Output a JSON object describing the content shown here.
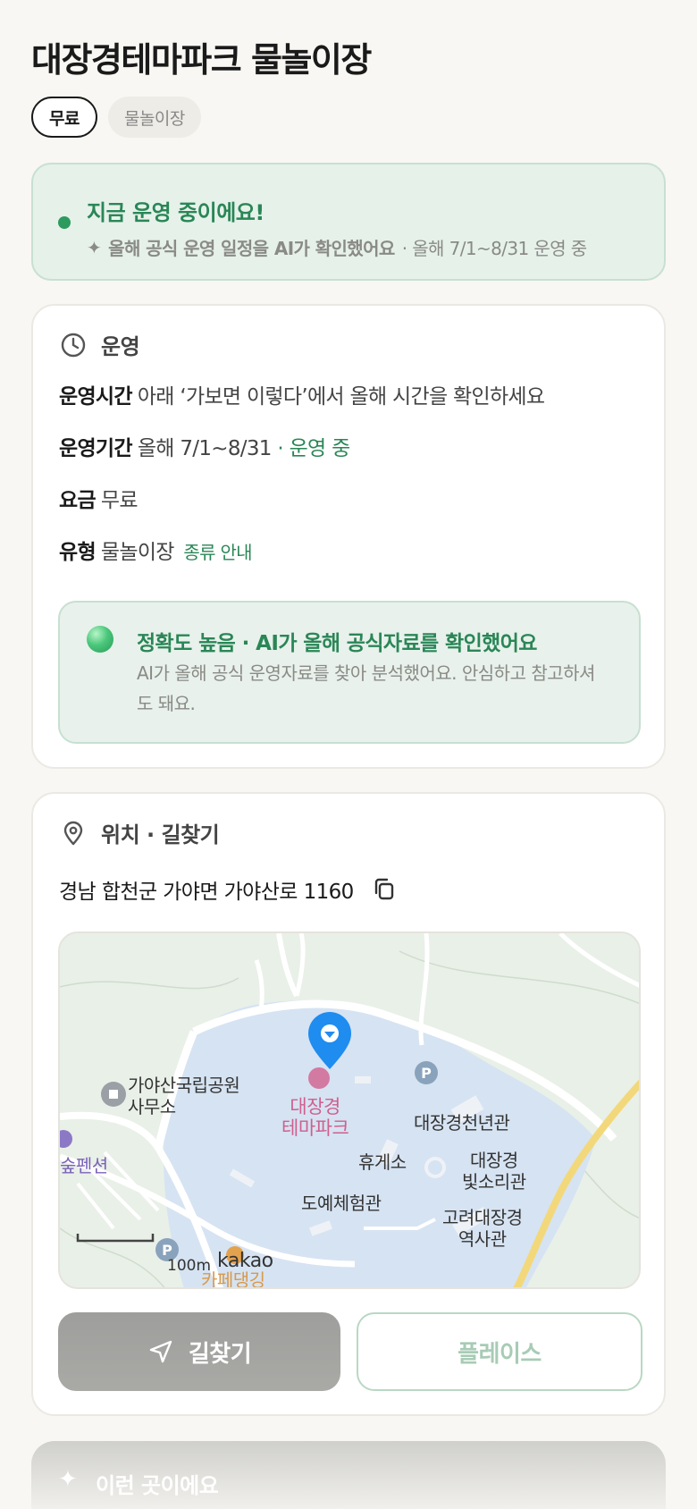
{
  "header": {
    "title": "대장경테마파크 물놀이장",
    "chips": [
      "무료",
      "물놀이장"
    ]
  },
  "status": {
    "title": "지금 운영 중이에요!",
    "sub_em": "올해 공식 운영 일정을 AI가 확인했어요",
    "sub_rest": "· 올해 7/1~8/31 운영 중"
  },
  "operation": {
    "section_label": "운영",
    "hours_key": "운영시간",
    "hours_value": "아래 ‘가보면 이렇다’에서 올해 시간을 확인하세요",
    "period_key": "운영기간",
    "period_value": "올해 7/1~8/31",
    "period_status": "· 운영 중",
    "fee_key": "요금",
    "fee_value": "무료",
    "type_key": "유형",
    "type_value": "물놀이장",
    "type_link": "종류 안내",
    "accuracy_title": "정확도 높음 · AI가 올해 공식자료를 확인했어요",
    "accuracy_body": "AI가 올해 공식 운영자료를 찾아 분석했어요. 안심하고 참고하셔도 돼요."
  },
  "location": {
    "section_label": "위치 · 길찾기",
    "address": "경남 합천군 가야면 가야산로 1160",
    "map_labels": {
      "park_office_1": "가야산국립공원",
      "park_office_2": "사무소",
      "theme_park_1": "대장경",
      "theme_park_2": "테마파크",
      "hall_1000": "대장경천년관",
      "rest_area": "휴게소",
      "sound_hall_1": "대장경",
      "sound_hall_2": "빛소리관",
      "pottery": "도예체험관",
      "history_1": "고려대장경",
      "history_2": "역사관",
      "pension": "숲펜션",
      "cafe": "카페댕깅",
      "scale": "100m",
      "brand": "kakao"
    },
    "nav_button": "길찾기",
    "place_button": "플레이스"
  },
  "peek": {
    "label": "이런 곳이에요"
  },
  "colors": {
    "accent_green": "#2a8656",
    "status_bg": "#e6f1ea",
    "pin_blue": "#1f8cf0"
  }
}
